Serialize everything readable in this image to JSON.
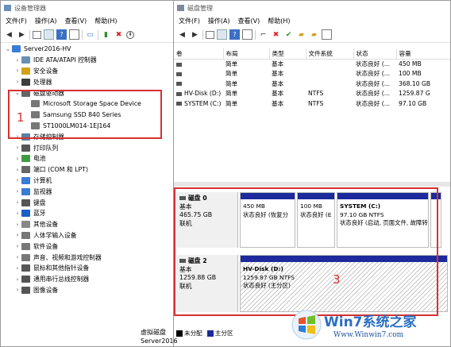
{
  "device_manager": {
    "title": "设备管理器",
    "menu": [
      "文件(F)",
      "操作(A)",
      "查看(V)",
      "帮助(H)"
    ],
    "tree": [
      {
        "label": "Server2016-HV",
        "level": 0,
        "expanded": true,
        "icon": "computer-icon",
        "color": "#3a7bd5"
      },
      {
        "label": "IDE ATA/ATAPI 控制器",
        "level": 1,
        "icon": "ide-icon",
        "color": "#6a8fb5"
      },
      {
        "label": "安全设备",
        "level": 1,
        "icon": "security-icon",
        "color": "#d4a017"
      },
      {
        "label": "处理器",
        "level": 1,
        "icon": "cpu-icon",
        "color": "#3d3d3d"
      },
      {
        "label": "磁盘驱动器",
        "level": 1,
        "expanded": true,
        "icon": "disk-drive-icon",
        "color": "#666666"
      },
      {
        "label": "Microsoft Storage Space Device",
        "level": 2,
        "icon": "drive-icon",
        "color": "#777777"
      },
      {
        "label": "Samsung SSD 840 Series",
        "level": 2,
        "icon": "drive-icon",
        "color": "#777777"
      },
      {
        "label": "ST1000LM014-1EJ164",
        "level": 2,
        "icon": "drive-icon",
        "color": "#777777"
      },
      {
        "label": "存储控制器",
        "level": 1,
        "icon": "storage-icon",
        "color": "#5c7fa3"
      },
      {
        "label": "打印队列",
        "level": 1,
        "icon": "printer-icon",
        "color": "#555555"
      },
      {
        "label": "电池",
        "level": 1,
        "icon": "battery-icon",
        "color": "#3f9b3f"
      },
      {
        "label": "端口 (COM 和 LPT)",
        "level": 1,
        "icon": "port-icon",
        "color": "#666666"
      },
      {
        "label": "计算机",
        "level": 1,
        "icon": "computer-icon",
        "color": "#3a7bd5"
      },
      {
        "label": "监视器",
        "level": 1,
        "icon": "monitor-icon",
        "color": "#3a7bd5"
      },
      {
        "label": "键盘",
        "level": 1,
        "icon": "keyboard-icon",
        "color": "#555555"
      },
      {
        "label": "蓝牙",
        "level": 1,
        "icon": "bluetooth-icon",
        "color": "#1a5fc4"
      },
      {
        "label": "其他设备",
        "level": 1,
        "icon": "other-device-icon",
        "color": "#888888"
      },
      {
        "label": "人体学输入设备",
        "level": 1,
        "icon": "hid-icon",
        "color": "#777777"
      },
      {
        "label": "软件设备",
        "level": 1,
        "icon": "software-icon",
        "color": "#777777"
      },
      {
        "label": "声音、视频和游戏控制器",
        "level": 1,
        "icon": "sound-icon",
        "color": "#777777"
      },
      {
        "label": "鼠标和其他指针设备",
        "level": 1,
        "icon": "mouse-icon",
        "color": "#555555"
      },
      {
        "label": "通用串行总线控制器",
        "level": 1,
        "icon": "usb-icon",
        "color": "#555555"
      },
      {
        "label": "图像设备",
        "level": 1,
        "icon": "camera-icon",
        "color": "#555555"
      }
    ],
    "annotation_1": "1"
  },
  "disk_mgmt": {
    "title": "磁盘管理",
    "menu": [
      "文件(F)",
      "操作(A)",
      "查看(V)",
      "帮助(H)"
    ],
    "columns": [
      "卷",
      "布局",
      "类型",
      "文件系统",
      "状态",
      "容量"
    ],
    "volumes": [
      {
        "name": "",
        "layout": "简单",
        "type": "基本",
        "fs": "",
        "status": "状态良好 (...",
        "capacity": "450 MB"
      },
      {
        "name": "",
        "layout": "简单",
        "type": "基本",
        "fs": "",
        "status": "状态良好 (...",
        "capacity": "100 MB"
      },
      {
        "name": "",
        "layout": "简单",
        "type": "基本",
        "fs": "",
        "status": "状态良好 (...",
        "capacity": "368.10 GB"
      },
      {
        "name": "HV-Disk (D:)",
        "layout": "简单",
        "type": "基本",
        "fs": "NTFS",
        "status": "状态良好 (...",
        "capacity": "1259.87 G"
      },
      {
        "name": "SYSTEM (C:)",
        "layout": "简单",
        "type": "基本",
        "fs": "NTFS",
        "status": "状态良好 (...",
        "capacity": "97.10 GB"
      }
    ],
    "disks": [
      {
        "name": "磁盘 0",
        "type": "基本",
        "size": "465.75 GB",
        "state": "联机",
        "partitions": [
          {
            "title": "",
            "line1": "450 MB",
            "line2": "状态良好 (恢复分",
            "hatch": false
          },
          {
            "title": "",
            "line1": "100 MB",
            "line2": "状态良好 (E",
            "hatch": false
          },
          {
            "title": "SYSTEM  (C:)",
            "line1": "97.10 GB NTFS",
            "line2": "状态良好 (启动, 页面文件, 故障转",
            "hatch": false
          },
          {
            "title": "",
            "line1": "",
            "line2": "",
            "hatch": false
          }
        ]
      },
      {
        "name": "磁盘 2",
        "type": "基本",
        "size": "1259.88 GB",
        "state": "联机",
        "partitions": [
          {
            "title": "HV-Disk  (D:)",
            "line1": "1259.87 GB NTFS",
            "line2": "状态良好 (主分区)",
            "hatch": true
          }
        ]
      }
    ],
    "annotation_3": "3",
    "footer_left": "虚拟磁盘",
    "footer_sub": "Server2016",
    "legend": [
      {
        "label": "未分配",
        "color": "#000000"
      },
      {
        "label": "主分区",
        "color": "#1c2a9c"
      }
    ]
  },
  "watermark": {
    "brand": "Win7系统之家",
    "url": "Www.Winwin7.com"
  }
}
